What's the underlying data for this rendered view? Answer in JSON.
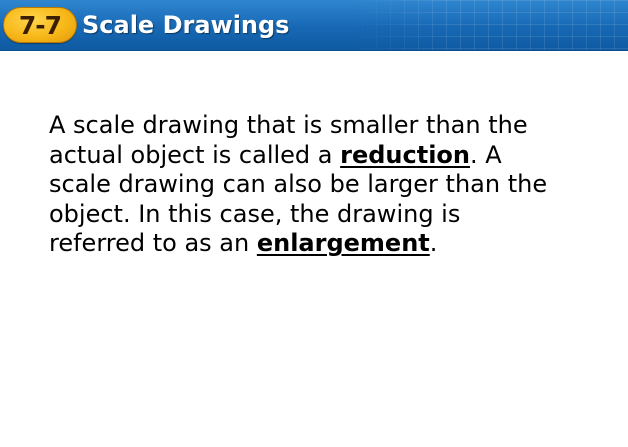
{
  "header": {
    "lesson_number": "7-7",
    "lesson_title": "Scale Drawings"
  },
  "body": {
    "line1": "A scale drawing that is smaller than the",
    "line2_pre": "actual object is called a ",
    "term_reduction": "reduction",
    "line2_post": ". A",
    "line3": "scale drawing can also be larger than the",
    "line4": "object. In this case, the drawing is",
    "line5_pre": "referred to as an ",
    "term_enlargement": "enlargement",
    "line5_post": "."
  },
  "colors": {
    "banner": "#1768b4",
    "badge": "#f7b718",
    "title_text": "#ffffff",
    "body_text": "#000000"
  }
}
